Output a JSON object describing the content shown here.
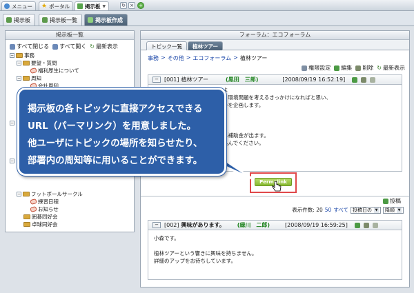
{
  "top_tabs": [
    {
      "label": "メニュー",
      "icon": "globe-icon"
    },
    {
      "label": "ポータル",
      "icon": "star-icon"
    },
    {
      "label": "掲示板",
      "icon": "board-icon",
      "active": true
    }
  ],
  "sub_tabs": [
    {
      "label": "掲示板",
      "icon": "board-icon"
    },
    {
      "label": "掲示板一覧",
      "icon": "board-icon"
    },
    {
      "label": "掲示板作成",
      "icon": "board-icon",
      "active": true
    }
  ],
  "left_panel": {
    "title": "掲示板一覧",
    "toolbar": {
      "close_all": "すべて閉じる",
      "open_all": "すべて開く",
      "refresh": "最新表示"
    },
    "tree": [
      "事務",
      "要望・質問",
      "福利厚生について",
      "周知",
      "会社周知",
      "",
      "",
      "",
      "",
      "",
      "",
      "フットボールサークル",
      "練習日程",
      "お知らせ",
      "囲碁同好会",
      "卓球同好会"
    ]
  },
  "right_panel": {
    "title": "フォーラム：エコフォーラム",
    "tabs": [
      "トピック一覧",
      "植林ツアー"
    ],
    "breadcrumb": [
      "事務",
      "その他",
      "エコフォーラム",
      "植林ツアー"
    ],
    "breadcrumb_sep": ">",
    "toolbar": {
      "perm": "権限設定",
      "edit": "編集",
      "delete": "削除",
      "refresh": "最新表示"
    },
    "topic1": {
      "no": "[001]",
      "title": "植林ツアー",
      "author": "(黒田　三郎)",
      "datetime": "[2008/09/19 16:52:19]",
      "body_fragments": [
        "よ",
        "、環境問題を考えるきっかけになればと思い、",
        "ーを企画します。",
        "",
        "ら補助金が出ます。",
        "込んでください。"
      ]
    },
    "permalink_label": "Permalink",
    "post_label": "投稿",
    "count_label": "表示件数: 20",
    "count_50": "50",
    "count_all": "すべて",
    "sort_field": "投稿日の",
    "sort_order": "降順",
    "topic2": {
      "no": "[002]",
      "title": "興味があります。",
      "author": "(緑川　二郎)",
      "datetime": "[2008/09/19 16:59:25]",
      "body": [
        "小森です。",
        "",
        "植林ツアーという響きに興味を持ちません。",
        "詳細のアップをお待ちしています。"
      ]
    }
  },
  "callout": {
    "lines": [
      "掲示板の各トピックに直接アクセスできる",
      "URL（パーマリンク）を用意しました。",
      "他ユーザにトピックの場所を知らせたり、",
      "部署内の周知等に用いることができます。"
    ]
  },
  "colors": {
    "callout_bg": "#2d5fa8",
    "permalink_highlight": "#e0484a",
    "author_green": "#198019",
    "link_blue": "#1a46a8"
  }
}
